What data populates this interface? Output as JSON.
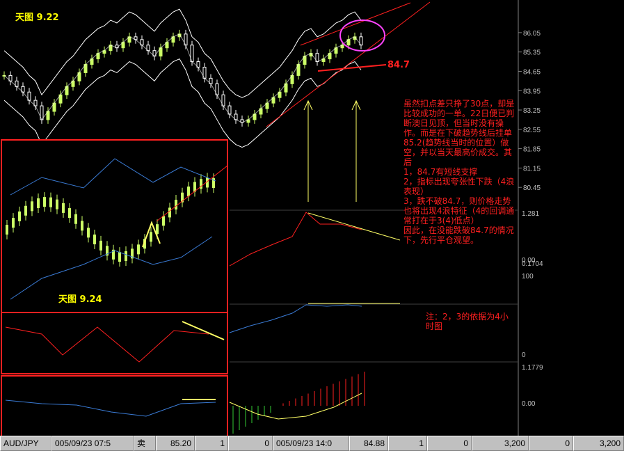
{
  "chart_data": [
    {
      "type": "candlestick",
      "title": "天图 9.22",
      "instrument": "AUD/JPY",
      "y_tick_labels": [
        "86.05",
        "85.35",
        "84.65",
        "83.95",
        "83.25",
        "82.55",
        "81.85",
        "81.15",
        "80.45"
      ],
      "ylim": [
        79.8,
        86.4
      ],
      "grid": false,
      "annotations": {
        "support_level": "84.7",
        "note": "虽然扣点差只挣了30点，却是比较成功的一单。22日便已判断澳日见顶，但当时没有操作。而是在下破趋势线后挂单85.2(趋势线当时的位置）做空，并以当天最高价成交。其后\n1，84.7有短线支撑\n2，指标出现夸张性下跌（4浪表现）\n3，跌不破84.7，则价格走势也将出现4浪特征（4的回调通常打在于3(4)低点）\n因此，在没能跌破84.7的情况下，先行平仓观望。",
        "footnote": "注：2，3的依据为4小时图"
      },
      "series": [
        {
          "name": "candles",
          "close_approx": [
            84.5,
            84.3,
            84.1,
            83.9,
            83.6,
            83.4,
            82.9,
            83.2,
            83.5,
            83.8,
            84.1,
            84.3,
            84.6,
            84.9,
            85.1,
            85.3,
            85.4,
            85.6,
            85.5,
            85.7,
            85.9,
            85.8,
            85.6,
            85.4,
            85.2,
            85.5,
            85.7,
            85.9,
            86.0,
            85.6,
            85.0,
            84.8,
            84.4,
            84.2,
            83.8,
            83.4,
            83.1,
            82.9,
            82.8,
            82.9,
            83.1,
            83.3,
            83.5,
            83.7,
            83.9,
            84.2,
            84.5,
            84.9,
            85.2,
            85.3,
            85.0,
            85.1,
            85.3,
            85.5,
            85.6,
            85.8,
            85.9,
            85.6
          ]
        }
      ],
      "indicator_ticks": [
        "1.281",
        "0.00",
        "0.1704",
        "100",
        "0",
        "1.1779",
        "0.00"
      ]
    },
    {
      "type": "candlestick",
      "title": "天图 9.24",
      "note": "inset chart"
    }
  ],
  "statusbar": {
    "symbol": "AUD/JPY",
    "date1": "005/09/23 07:5",
    "side": "卖",
    "price1": "85.20",
    "qty1": "1",
    "zero1": "0",
    "date2": "005/09/23 14:0",
    "price2": "84.88",
    "qty2": "1",
    "zero2": "0",
    "amount1": "3,200",
    "zero3": "0",
    "amount2": "3,200"
  },
  "colors": {
    "bg": "#000000",
    "up": "#ccff66",
    "down": "#ffffff",
    "band": "#ffffff",
    "inset_band": "#3a7bd5",
    "trend": "#ff2020",
    "accent": "#ffff66",
    "circle": "#ff44ff"
  }
}
